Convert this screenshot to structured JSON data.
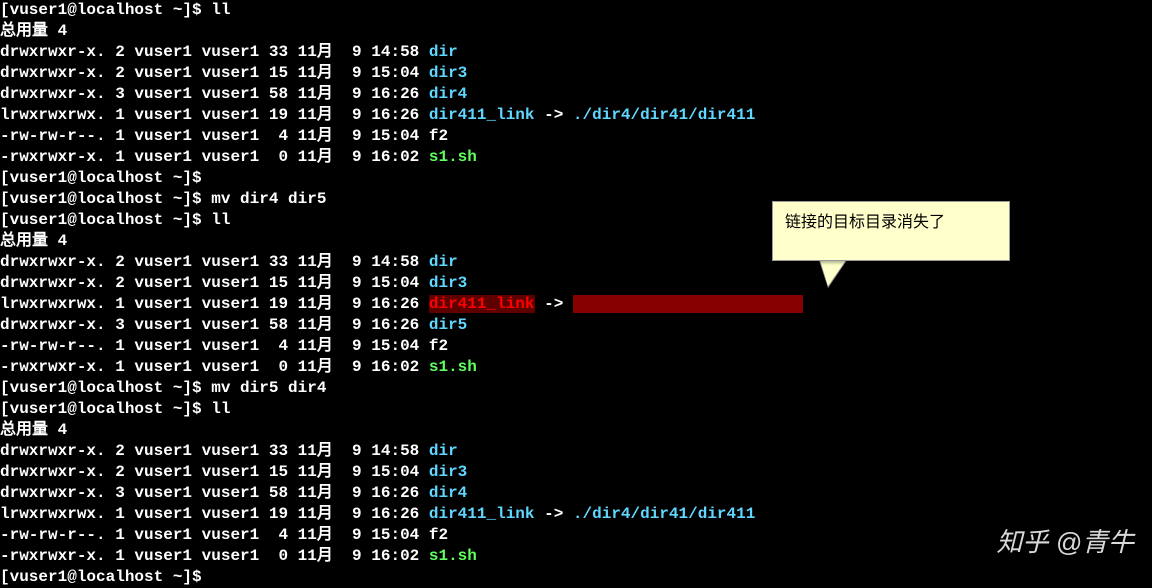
{
  "prompt": "[vuser1@localhost ~]$ ",
  "cmd_ll": "ll",
  "cmd_mv45": "mv dir4 dir5",
  "cmd_mv54": "mv dir5 dir4",
  "total": "总用量 4",
  "link_arrow": " -> ",
  "link_target": "./dir4/dir41/dir411",
  "rows1": [
    {
      "meta": "drwxrwxr-x. 2 vuser1 vuser1 33 11月  9 14:58 ",
      "name": "dir",
      "cls": "dir"
    },
    {
      "meta": "drwxrwxr-x. 2 vuser1 vuser1 15 11月  9 15:04 ",
      "name": "dir3",
      "cls": "dir"
    },
    {
      "meta": "drwxrwxr-x. 3 vuser1 vuser1 58 11月  9 16:26 ",
      "name": "dir4",
      "cls": "dir"
    },
    {
      "meta": "lrwxrwxrwx. 1 vuser1 vuser1 19 11月  9 16:26 ",
      "name": "dir411_link",
      "cls": "link",
      "islink": true
    },
    {
      "meta": "-rw-rw-r--. 1 vuser1 vuser1  4 11月  9 15:04 ",
      "name": "f2",
      "cls": ""
    },
    {
      "meta": "-rwxrwxr-x. 1 vuser1 vuser1  0 11月  9 16:02 ",
      "name": "s1.sh",
      "cls": "exec"
    }
  ],
  "rows2": [
    {
      "meta": "drwxrwxr-x. 2 vuser1 vuser1 33 11月  9 14:58 ",
      "name": "dir",
      "cls": "dir"
    },
    {
      "meta": "drwxrwxr-x. 2 vuser1 vuser1 15 11月  9 15:04 ",
      "name": "dir3",
      "cls": "dir"
    },
    {
      "meta": "lrwxrwxrwx. 1 vuser1 vuser1 19 11月  9 16:26 ",
      "name": "dir411_link",
      "cls": "brokenlink",
      "isbroken": true
    },
    {
      "meta": "drwxrwxr-x. 3 vuser1 vuser1 58 11月  9 16:26 ",
      "name": "dir5",
      "cls": "dir"
    },
    {
      "meta": "-rw-rw-r--. 1 vuser1 vuser1  4 11月  9 15:04 ",
      "name": "f2",
      "cls": ""
    },
    {
      "meta": "-rwxrwxr-x. 1 vuser1 vuser1  0 11月  9 16:02 ",
      "name": "s1.sh",
      "cls": "exec"
    }
  ],
  "rows3": [
    {
      "meta": "drwxrwxr-x. 2 vuser1 vuser1 33 11月  9 14:58 ",
      "name": "dir",
      "cls": "dir"
    },
    {
      "meta": "drwxrwxr-x. 2 vuser1 vuser1 15 11月  9 15:04 ",
      "name": "dir3",
      "cls": "dir"
    },
    {
      "meta": "drwxrwxr-x. 3 vuser1 vuser1 58 11月  9 16:26 ",
      "name": "dir4",
      "cls": "dir"
    },
    {
      "meta": "lrwxrwxrwx. 1 vuser1 vuser1 19 11月  9 16:26 ",
      "name": "dir411_link",
      "cls": "link",
      "islink": true
    },
    {
      "meta": "-rw-rw-r--. 1 vuser1 vuser1  4 11月  9 15:04 ",
      "name": "f2",
      "cls": ""
    },
    {
      "meta": "-rwxrwxr-x. 1 vuser1 vuser1  0 11月  9 16:02 ",
      "name": "s1.sh",
      "cls": "exec"
    }
  ],
  "callout_text": "链接的目标目录消失了",
  "broken_target_pad": "                        ",
  "watermark": "知乎 @青牛"
}
